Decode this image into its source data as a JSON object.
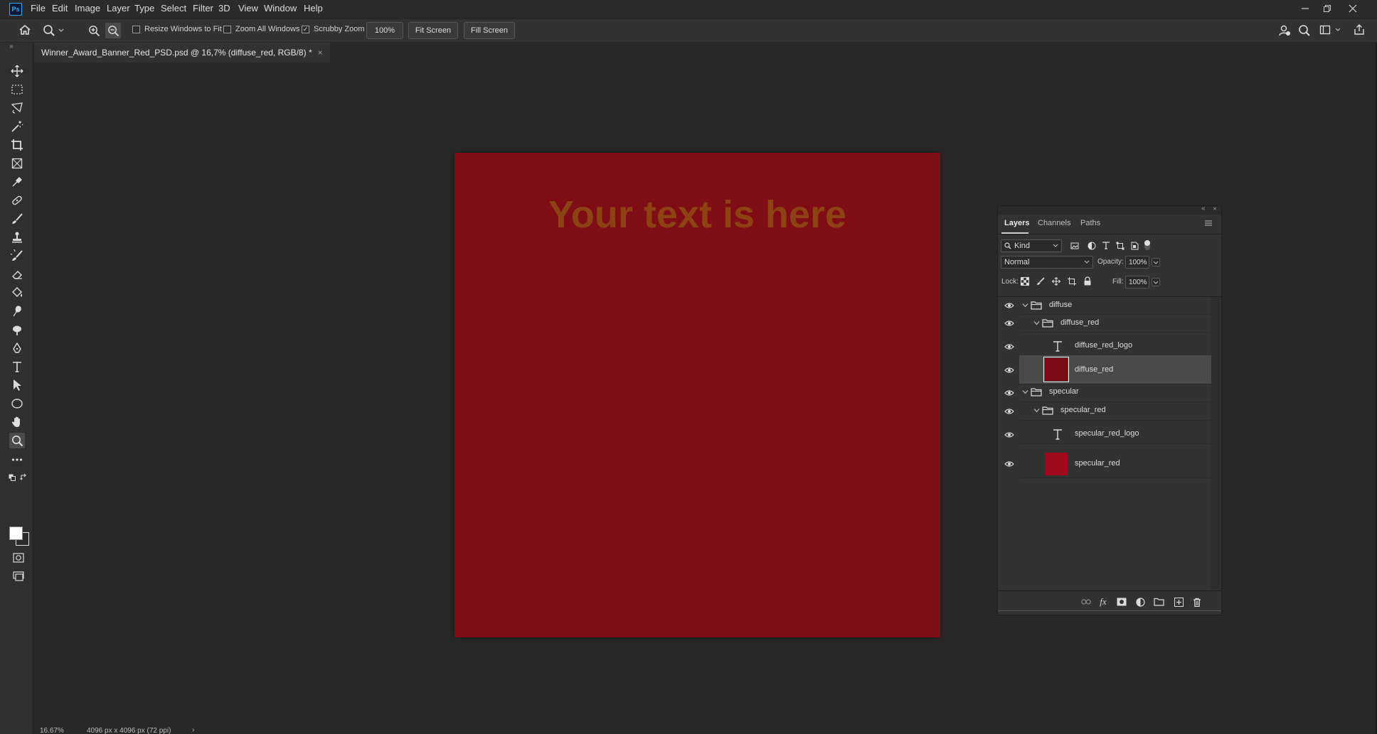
{
  "menu": {
    "app_icon": "Ps",
    "items": [
      "File",
      "Edit",
      "Image",
      "Layer",
      "Type",
      "Select",
      "Filter",
      "3D",
      "View",
      "Window",
      "Help"
    ]
  },
  "window_controls": [
    "minimize-icon",
    "restore-icon",
    "close-icon"
  ],
  "options_bar": {
    "home_icon": "home-icon",
    "zoom_tool_icon": "zoom-icon",
    "zoom_in_icon": "zoom-in-icon",
    "zoom_out_icon": "zoom-out-icon",
    "resize_windows": {
      "label": "Resize Windows to Fit",
      "checked": false
    },
    "zoom_all": {
      "label": "Zoom All Windows",
      "checked": false
    },
    "scrubby_zoom": {
      "label": "Scrubby Zoom",
      "checked": true
    },
    "zoom_value": "100%",
    "fit_screen": "Fit Screen",
    "fill_screen": "Fill Screen",
    "check_glyph": "✓",
    "right_icons": [
      "share-user-icon",
      "search-icon",
      "workspace-icon",
      "share-icon"
    ]
  },
  "document": {
    "tab_title": "Winner_Award_Banner_Red_PSD.psd @ 16,7% (diffuse_red, RGB/8) *",
    "tab_close": "×",
    "canvas_color": "#800d16",
    "canvas_text": "Your text is here",
    "canvas_text_color": "#8c4213"
  },
  "tools": [
    "move-tool-icon",
    "marquee-tool-icon",
    "lasso-tool-icon",
    "magic-wand-icon",
    "crop-tool-icon",
    "frame-tool-icon",
    "eyedropper-icon",
    "healing-brush-icon",
    "brush-tool-icon",
    "clone-stamp-icon",
    "history-brush-icon",
    "eraser-icon",
    "paint-bucket-icon",
    "smudge-tool-icon",
    "dodge-tool-icon",
    "pen-tool-icon",
    "type-tool-icon",
    "path-selection-icon",
    "ellipse-tool-icon",
    "hand-tool-icon",
    "zoom-tool-icon",
    "more-tools-icon"
  ],
  "status": {
    "zoom": "16.67%",
    "dimensions": "4096 px x 4096 px (72 ppi)"
  },
  "layers_panel": {
    "tabs": [
      "Layers",
      "Channels",
      "Paths"
    ],
    "filter_kind": "Kind",
    "blend_mode": "Normal",
    "opacity_label": "Opacity:",
    "opacity_value": "100%",
    "lock_label": "Lock:",
    "fill_label": "Fill:",
    "fill_value": "100%",
    "layers": [
      {
        "name": "diffuse",
        "kind": "group",
        "indent": 0,
        "selected": false
      },
      {
        "name": "diffuse_red",
        "kind": "group",
        "indent": 1,
        "selected": false
      },
      {
        "name": "diffuse_red_logo",
        "kind": "text",
        "indent": 2,
        "selected": false
      },
      {
        "name": "diffuse_red",
        "kind": "fill",
        "indent": 2,
        "selected": true,
        "color": "#7d0a14"
      },
      {
        "name": "specular",
        "kind": "group",
        "indent": 0,
        "selected": false
      },
      {
        "name": "specular_red",
        "kind": "group",
        "indent": 1,
        "selected": false
      },
      {
        "name": "specular_red_logo",
        "kind": "text",
        "indent": 2,
        "selected": false
      },
      {
        "name": "specular_red",
        "kind": "fill",
        "indent": 2,
        "selected": false,
        "color": "#a00a1c"
      }
    ],
    "footer_icons": [
      "link-layers-icon",
      "fx-icon",
      "add-mask-icon",
      "adjustment-layer-icon",
      "new-group-icon",
      "new-layer-icon",
      "delete-layer-icon"
    ]
  },
  "colors": {
    "foreground": "#ffffff",
    "background": "#2b2b2b",
    "accent": "#31a8ff"
  }
}
